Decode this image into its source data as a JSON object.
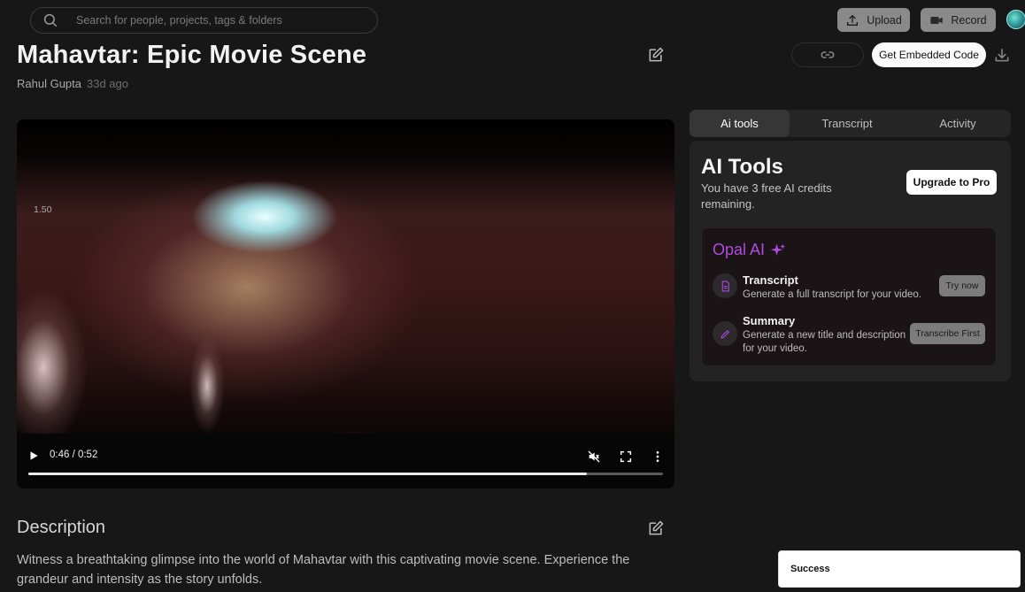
{
  "search": {
    "placeholder": "Search for people, projects, tags & folders"
  },
  "header": {
    "upload_label": "Upload",
    "record_label": "Record"
  },
  "video": {
    "title": "Mahavtar: Epic Movie Scene",
    "author": "Rahul Gupta",
    "age": "33d ago",
    "embed_label": "Get Embedded Code",
    "speed_overlay": "1.50",
    "time": "0:46 / 0:52",
    "progress_fraction": 0.88
  },
  "description": {
    "heading": "Description",
    "text": "Witness a breathtaking glimpse into the world of Mahavtar with this captivating movie scene. Experience the grandeur and intensity as the story unfolds."
  },
  "right_panel": {
    "tabs": [
      {
        "label": "Ai tools",
        "active": true
      },
      {
        "label": "Transcript",
        "active": false
      },
      {
        "label": "Activity",
        "active": false
      }
    ],
    "ai_tools": {
      "title": "AI Tools",
      "subtitle": "You have 3 free AI credits remaining.",
      "upgrade_label": "Upgrade to Pro",
      "opal_title": "Opal AI",
      "tools": [
        {
          "name": "Transcript",
          "desc": "Generate a full transcript for your video.",
          "button": "Try now",
          "icon": "document-icon"
        },
        {
          "name": "Summary",
          "desc": "Generate a new title and description for your video.",
          "button": "Transcribe First",
          "icon": "pen-icon"
        }
      ]
    }
  },
  "toast": {
    "message": "Success"
  },
  "colors": {
    "accent_purple": "#b04ae0",
    "background": "#171717",
    "panel": "#232323"
  }
}
